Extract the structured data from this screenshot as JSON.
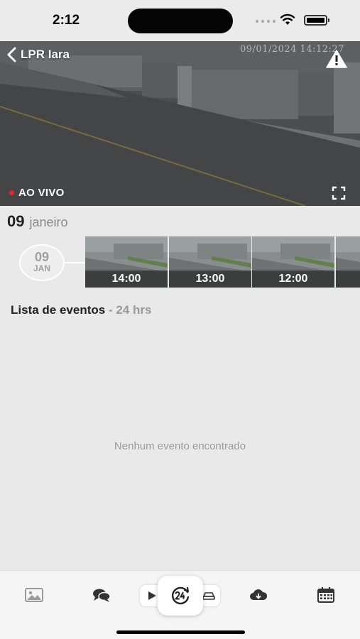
{
  "status_bar": {
    "time": "2:12"
  },
  "video": {
    "back_label": "LPR Iara",
    "timestamp": "09/01/2024 14:12:27",
    "live_label": "AO VIVO"
  },
  "date_header": {
    "day": "09",
    "month": "janeiro"
  },
  "timeline": {
    "bubble_day": "09",
    "bubble_month": "JAN",
    "thumbnails": [
      {
        "label": "14:00"
      },
      {
        "label": "13:00"
      },
      {
        "label": "12:00"
      }
    ]
  },
  "events": {
    "title": "Lista de eventos",
    "range": " - 24 hrs",
    "empty_message": "Nenhum evento encontrado"
  },
  "bottom_bar": {
    "tabs": [
      "image-icon",
      "chat-icon",
      "play-icon",
      "24h-icon",
      "car-icon",
      "cloud-download-icon",
      "calendar-icon"
    ]
  },
  "colors": {
    "live": "#e22222",
    "background": "#e9e9e9"
  }
}
